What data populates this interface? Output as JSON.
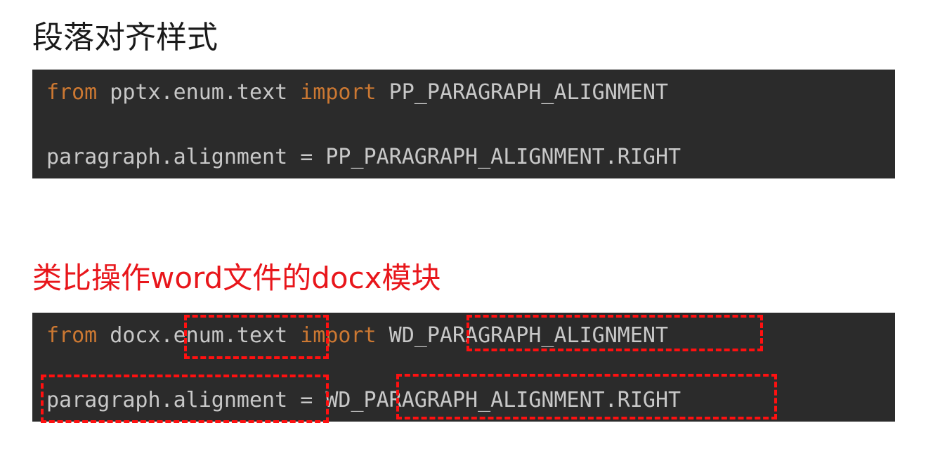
{
  "heading": "段落对齐样式",
  "block1": {
    "line1": {
      "kw_from": "from",
      "module": " pptx.enum.text ",
      "kw_import": "import",
      "name": " PP_PARAGRAPH_ALIGNMENT"
    },
    "line2": "paragraph.alignment = PP_PARAGRAPH_ALIGNMENT.RIGHT"
  },
  "subheading": "类比操作word文件的docx模块",
  "block2": {
    "line1": {
      "kw_from": "from",
      "module": " docx.enum.text ",
      "kw_import": "import",
      "name": " WD_PARAGRAPH_ALIGNMENT"
    },
    "line2": "paragraph.alignment = WD_PARAGRAPH_ALIGNMENT.RIGHT"
  },
  "colors": {
    "keyword": "#cc7832",
    "code_text": "#c8c8c8",
    "code_background": "#2b2b2b",
    "highlight": "#ff1010",
    "subheading": "#e8161b"
  }
}
